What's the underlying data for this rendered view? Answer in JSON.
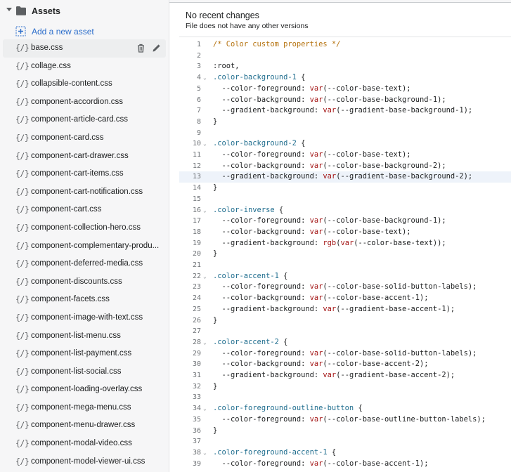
{
  "sidebar": {
    "folder_label": "Assets",
    "add_asset_label": "Add a new asset",
    "files": [
      {
        "icon": "{/}",
        "label": "base.css",
        "active": true
      },
      {
        "icon": "{/}",
        "label": "collage.css"
      },
      {
        "icon": "{/}",
        "label": "collapsible-content.css"
      },
      {
        "icon": "{/}",
        "label": "component-accordion.css"
      },
      {
        "icon": "{/}",
        "label": "component-article-card.css"
      },
      {
        "icon": "{/}",
        "label": "component-card.css"
      },
      {
        "icon": "{/}",
        "label": "component-cart-drawer.css"
      },
      {
        "icon": "{/}",
        "label": "component-cart-items.css"
      },
      {
        "icon": "{/}",
        "label": "component-cart-notification.css"
      },
      {
        "icon": "{/}",
        "label": "component-cart.css"
      },
      {
        "icon": "{/}",
        "label": "component-collection-hero.css"
      },
      {
        "icon": "{/}",
        "label": "component-complementary-produ..."
      },
      {
        "icon": "{/}",
        "label": "component-deferred-media.css"
      },
      {
        "icon": "{/}",
        "label": "component-discounts.css"
      },
      {
        "icon": "{/}",
        "label": "component-facets.css"
      },
      {
        "icon": "{/}",
        "label": "component-image-with-text.css"
      },
      {
        "icon": "{/}",
        "label": "component-list-menu.css"
      },
      {
        "icon": "{/}",
        "label": "component-list-payment.css"
      },
      {
        "icon": "{/}",
        "label": "component-list-social.css"
      },
      {
        "icon": "{/}",
        "label": "component-loading-overlay.css"
      },
      {
        "icon": "{/}",
        "label": "component-mega-menu.css"
      },
      {
        "icon": "{/}",
        "label": "component-menu-drawer.css"
      },
      {
        "icon": "{/}",
        "label": "component-modal-video.css"
      },
      {
        "icon": "{/}",
        "label": "component-model-viewer-ui.css"
      }
    ]
  },
  "main": {
    "changes_title": "No recent changes",
    "changes_subtitle": "File does not have any other versions"
  },
  "editor": {
    "highlighted_line": 13,
    "lines": [
      {
        "n": "1",
        "fold": false,
        "tokens": [
          [
            "t-comment",
            "/* Color custom properties */"
          ]
        ]
      },
      {
        "n": "2",
        "fold": false,
        "tokens": []
      },
      {
        "n": "3",
        "fold": false,
        "tokens": [
          [
            "t-punc",
            ":root,"
          ]
        ]
      },
      {
        "n": "4",
        "fold": true,
        "tokens": [
          [
            "t-selector",
            ".color-background-1"
          ],
          [
            "t-punc",
            " {"
          ]
        ]
      },
      {
        "n": "5",
        "fold": false,
        "tokens": [
          [
            "t-prop",
            "  --color-foreground: "
          ],
          [
            "t-fn",
            "var"
          ],
          [
            "t-punc",
            "(--color-base-text);"
          ]
        ]
      },
      {
        "n": "6",
        "fold": false,
        "tokens": [
          [
            "t-prop",
            "  --color-background: "
          ],
          [
            "t-fn",
            "var"
          ],
          [
            "t-punc",
            "(--color-base-background-1);"
          ]
        ]
      },
      {
        "n": "7",
        "fold": false,
        "tokens": [
          [
            "t-prop",
            "  --gradient-background: "
          ],
          [
            "t-fn",
            "var"
          ],
          [
            "t-punc",
            "(--gradient-base-background-1);"
          ]
        ]
      },
      {
        "n": "8",
        "fold": false,
        "tokens": [
          [
            "t-punc",
            "}"
          ]
        ]
      },
      {
        "n": "9",
        "fold": false,
        "tokens": []
      },
      {
        "n": "10",
        "fold": true,
        "tokens": [
          [
            "t-selector",
            ".color-background-2"
          ],
          [
            "t-punc",
            " {"
          ]
        ]
      },
      {
        "n": "11",
        "fold": false,
        "tokens": [
          [
            "t-prop",
            "  --color-foreground: "
          ],
          [
            "t-fn",
            "var"
          ],
          [
            "t-punc",
            "(--color-base-text);"
          ]
        ]
      },
      {
        "n": "12",
        "fold": false,
        "tokens": [
          [
            "t-prop",
            "  --color-background: "
          ],
          [
            "t-fn",
            "var"
          ],
          [
            "t-punc",
            "(--color-base-background-2);"
          ]
        ]
      },
      {
        "n": "13",
        "fold": false,
        "tokens": [
          [
            "t-prop",
            "  --gradient-background: "
          ],
          [
            "t-fn",
            "var"
          ],
          [
            "t-punc",
            "(--gradient-base-background-2);"
          ]
        ]
      },
      {
        "n": "14",
        "fold": false,
        "tokens": [
          [
            "t-punc",
            "}"
          ]
        ]
      },
      {
        "n": "15",
        "fold": false,
        "tokens": []
      },
      {
        "n": "16",
        "fold": true,
        "tokens": [
          [
            "t-selector",
            ".color-inverse"
          ],
          [
            "t-punc",
            " {"
          ]
        ]
      },
      {
        "n": "17",
        "fold": false,
        "tokens": [
          [
            "t-prop",
            "  --color-foreground: "
          ],
          [
            "t-fn",
            "var"
          ],
          [
            "t-punc",
            "(--color-base-background-1);"
          ]
        ]
      },
      {
        "n": "18",
        "fold": false,
        "tokens": [
          [
            "t-prop",
            "  --color-background: "
          ],
          [
            "t-fn",
            "var"
          ],
          [
            "t-punc",
            "(--color-base-text);"
          ]
        ]
      },
      {
        "n": "19",
        "fold": false,
        "tokens": [
          [
            "t-prop",
            "  --gradient-background: "
          ],
          [
            "t-fn",
            "rgb"
          ],
          [
            "t-punc",
            "("
          ],
          [
            "t-fn",
            "var"
          ],
          [
            "t-punc",
            "(--color-base-text));"
          ]
        ]
      },
      {
        "n": "20",
        "fold": false,
        "tokens": [
          [
            "t-punc",
            "}"
          ]
        ]
      },
      {
        "n": "21",
        "fold": false,
        "tokens": []
      },
      {
        "n": "22",
        "fold": true,
        "tokens": [
          [
            "t-selector",
            ".color-accent-1"
          ],
          [
            "t-punc",
            " {"
          ]
        ]
      },
      {
        "n": "23",
        "fold": false,
        "tokens": [
          [
            "t-prop",
            "  --color-foreground: "
          ],
          [
            "t-fn",
            "var"
          ],
          [
            "t-punc",
            "(--color-base-solid-button-labels);"
          ]
        ]
      },
      {
        "n": "24",
        "fold": false,
        "tokens": [
          [
            "t-prop",
            "  --color-background: "
          ],
          [
            "t-fn",
            "var"
          ],
          [
            "t-punc",
            "(--color-base-accent-1);"
          ]
        ]
      },
      {
        "n": "25",
        "fold": false,
        "tokens": [
          [
            "t-prop",
            "  --gradient-background: "
          ],
          [
            "t-fn",
            "var"
          ],
          [
            "t-punc",
            "(--gradient-base-accent-1);"
          ]
        ]
      },
      {
        "n": "26",
        "fold": false,
        "tokens": [
          [
            "t-punc",
            "}"
          ]
        ]
      },
      {
        "n": "27",
        "fold": false,
        "tokens": []
      },
      {
        "n": "28",
        "fold": true,
        "tokens": [
          [
            "t-selector",
            ".color-accent-2"
          ],
          [
            "t-punc",
            " {"
          ]
        ]
      },
      {
        "n": "29",
        "fold": false,
        "tokens": [
          [
            "t-prop",
            "  --color-foreground: "
          ],
          [
            "t-fn",
            "var"
          ],
          [
            "t-punc",
            "(--color-base-solid-button-labels);"
          ]
        ]
      },
      {
        "n": "30",
        "fold": false,
        "tokens": [
          [
            "t-prop",
            "  --color-background: "
          ],
          [
            "t-fn",
            "var"
          ],
          [
            "t-punc",
            "(--color-base-accent-2);"
          ]
        ]
      },
      {
        "n": "31",
        "fold": false,
        "tokens": [
          [
            "t-prop",
            "  --gradient-background: "
          ],
          [
            "t-fn",
            "var"
          ],
          [
            "t-punc",
            "(--gradient-base-accent-2);"
          ]
        ]
      },
      {
        "n": "32",
        "fold": false,
        "tokens": [
          [
            "t-punc",
            "}"
          ]
        ]
      },
      {
        "n": "33",
        "fold": false,
        "tokens": []
      },
      {
        "n": "34",
        "fold": true,
        "tokens": [
          [
            "t-selector",
            ".color-foreground-outline-button"
          ],
          [
            "t-punc",
            " {"
          ]
        ]
      },
      {
        "n": "35",
        "fold": false,
        "tokens": [
          [
            "t-prop",
            "  --color-foreground: "
          ],
          [
            "t-fn",
            "var"
          ],
          [
            "t-punc",
            "(--color-base-outline-button-labels);"
          ]
        ]
      },
      {
        "n": "36",
        "fold": false,
        "tokens": [
          [
            "t-punc",
            "}"
          ]
        ]
      },
      {
        "n": "37",
        "fold": false,
        "tokens": []
      },
      {
        "n": "38",
        "fold": true,
        "tokens": [
          [
            "t-selector",
            ".color-foreground-accent-1"
          ],
          [
            "t-punc",
            " {"
          ]
        ]
      },
      {
        "n": "39",
        "fold": false,
        "tokens": [
          [
            "t-prop",
            "  --color-foreground: "
          ],
          [
            "t-fn",
            "var"
          ],
          [
            "t-punc",
            "(--color-base-accent-1);"
          ]
        ]
      }
    ]
  },
  "colors": {
    "link": "#2c6ecb",
    "sidebar_bg": "#f6f6f7",
    "active_row": "#edeeef",
    "highlight_line": "#eef3fa"
  },
  "icons": {
    "folder": "folder-icon",
    "add": "add-file-icon",
    "file": "code-file-icon",
    "delete": "trash-icon",
    "edit": "pencil-icon",
    "collapse": "caret-down-icon",
    "fold": "chevron-down-icon"
  }
}
